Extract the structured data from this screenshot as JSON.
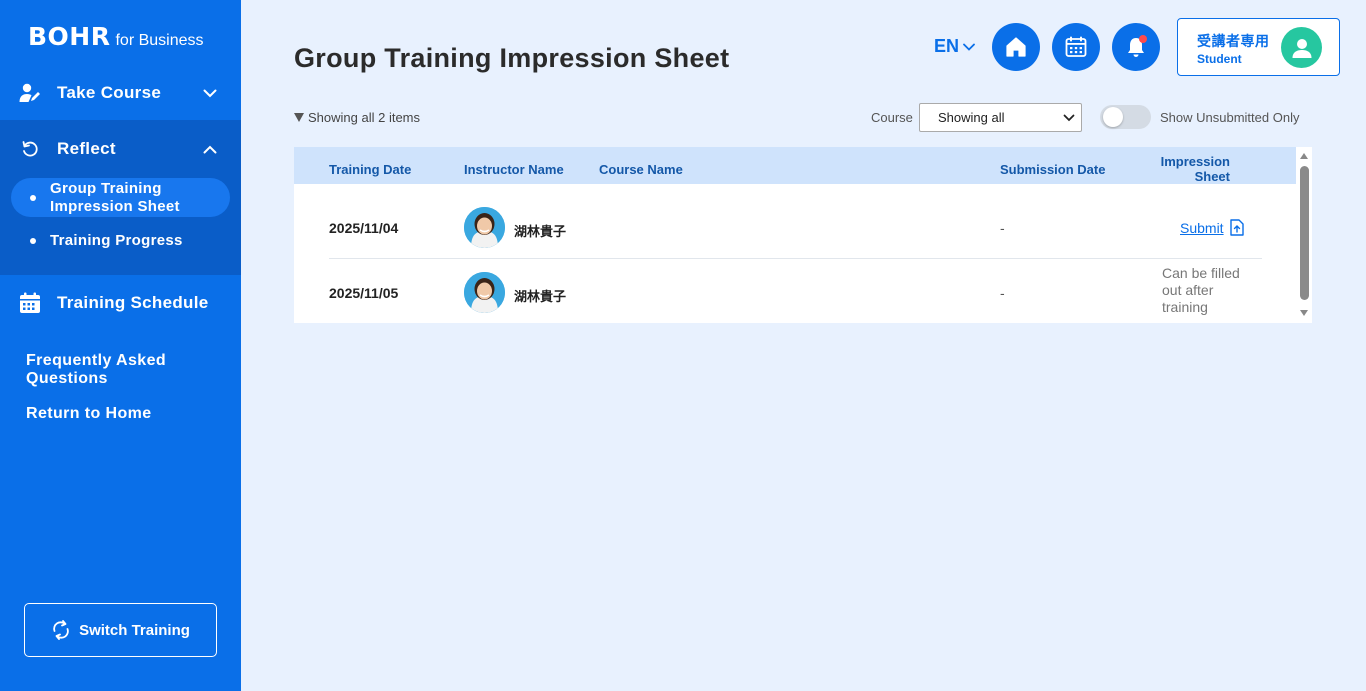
{
  "sidebar": {
    "logo_main": "BOHR",
    "logo_sub": "for Business",
    "take_course": "Take Course",
    "reflect": "Reflect",
    "sub_items": [
      "Group Training Impression Sheet",
      "Training Progress"
    ],
    "training_schedule": "Training Schedule",
    "faq": "Frequently Asked Questions",
    "return_home": "Return to Home",
    "switch_training": "Switch Training"
  },
  "header": {
    "title": "Group Training Impression Sheet",
    "language": "EN",
    "user_role": "受講者専用",
    "user_sub": "Student"
  },
  "filters": {
    "showing": "Showing all 2 items",
    "course_label": "Course",
    "course_value": "Showing all",
    "toggle_label": "Show Unsubmitted Only",
    "toggle_on": false
  },
  "table": {
    "headers": {
      "training_date": "Training Date",
      "instructor_name": "Instructor Name",
      "course_name": "Course Name",
      "submission_date": "Submission Date",
      "impression_sheet": "Impression Sheet"
    },
    "rows": [
      {
        "date": "2025/11/04",
        "instructor": "湖林貴子",
        "course": "",
        "submission_date": "-",
        "action": "Submit"
      },
      {
        "date": "2025/11/05",
        "instructor": "湖林貴子",
        "course": "",
        "submission_date": "-",
        "action": "Can be filled out after training"
      }
    ]
  },
  "colors": {
    "primary": "#0a6fe8",
    "sidebar_active": "#0a5dc8",
    "background": "#e8f1fe",
    "header_row": "#cfe3fc",
    "avatar_green": "#26c7a0"
  }
}
